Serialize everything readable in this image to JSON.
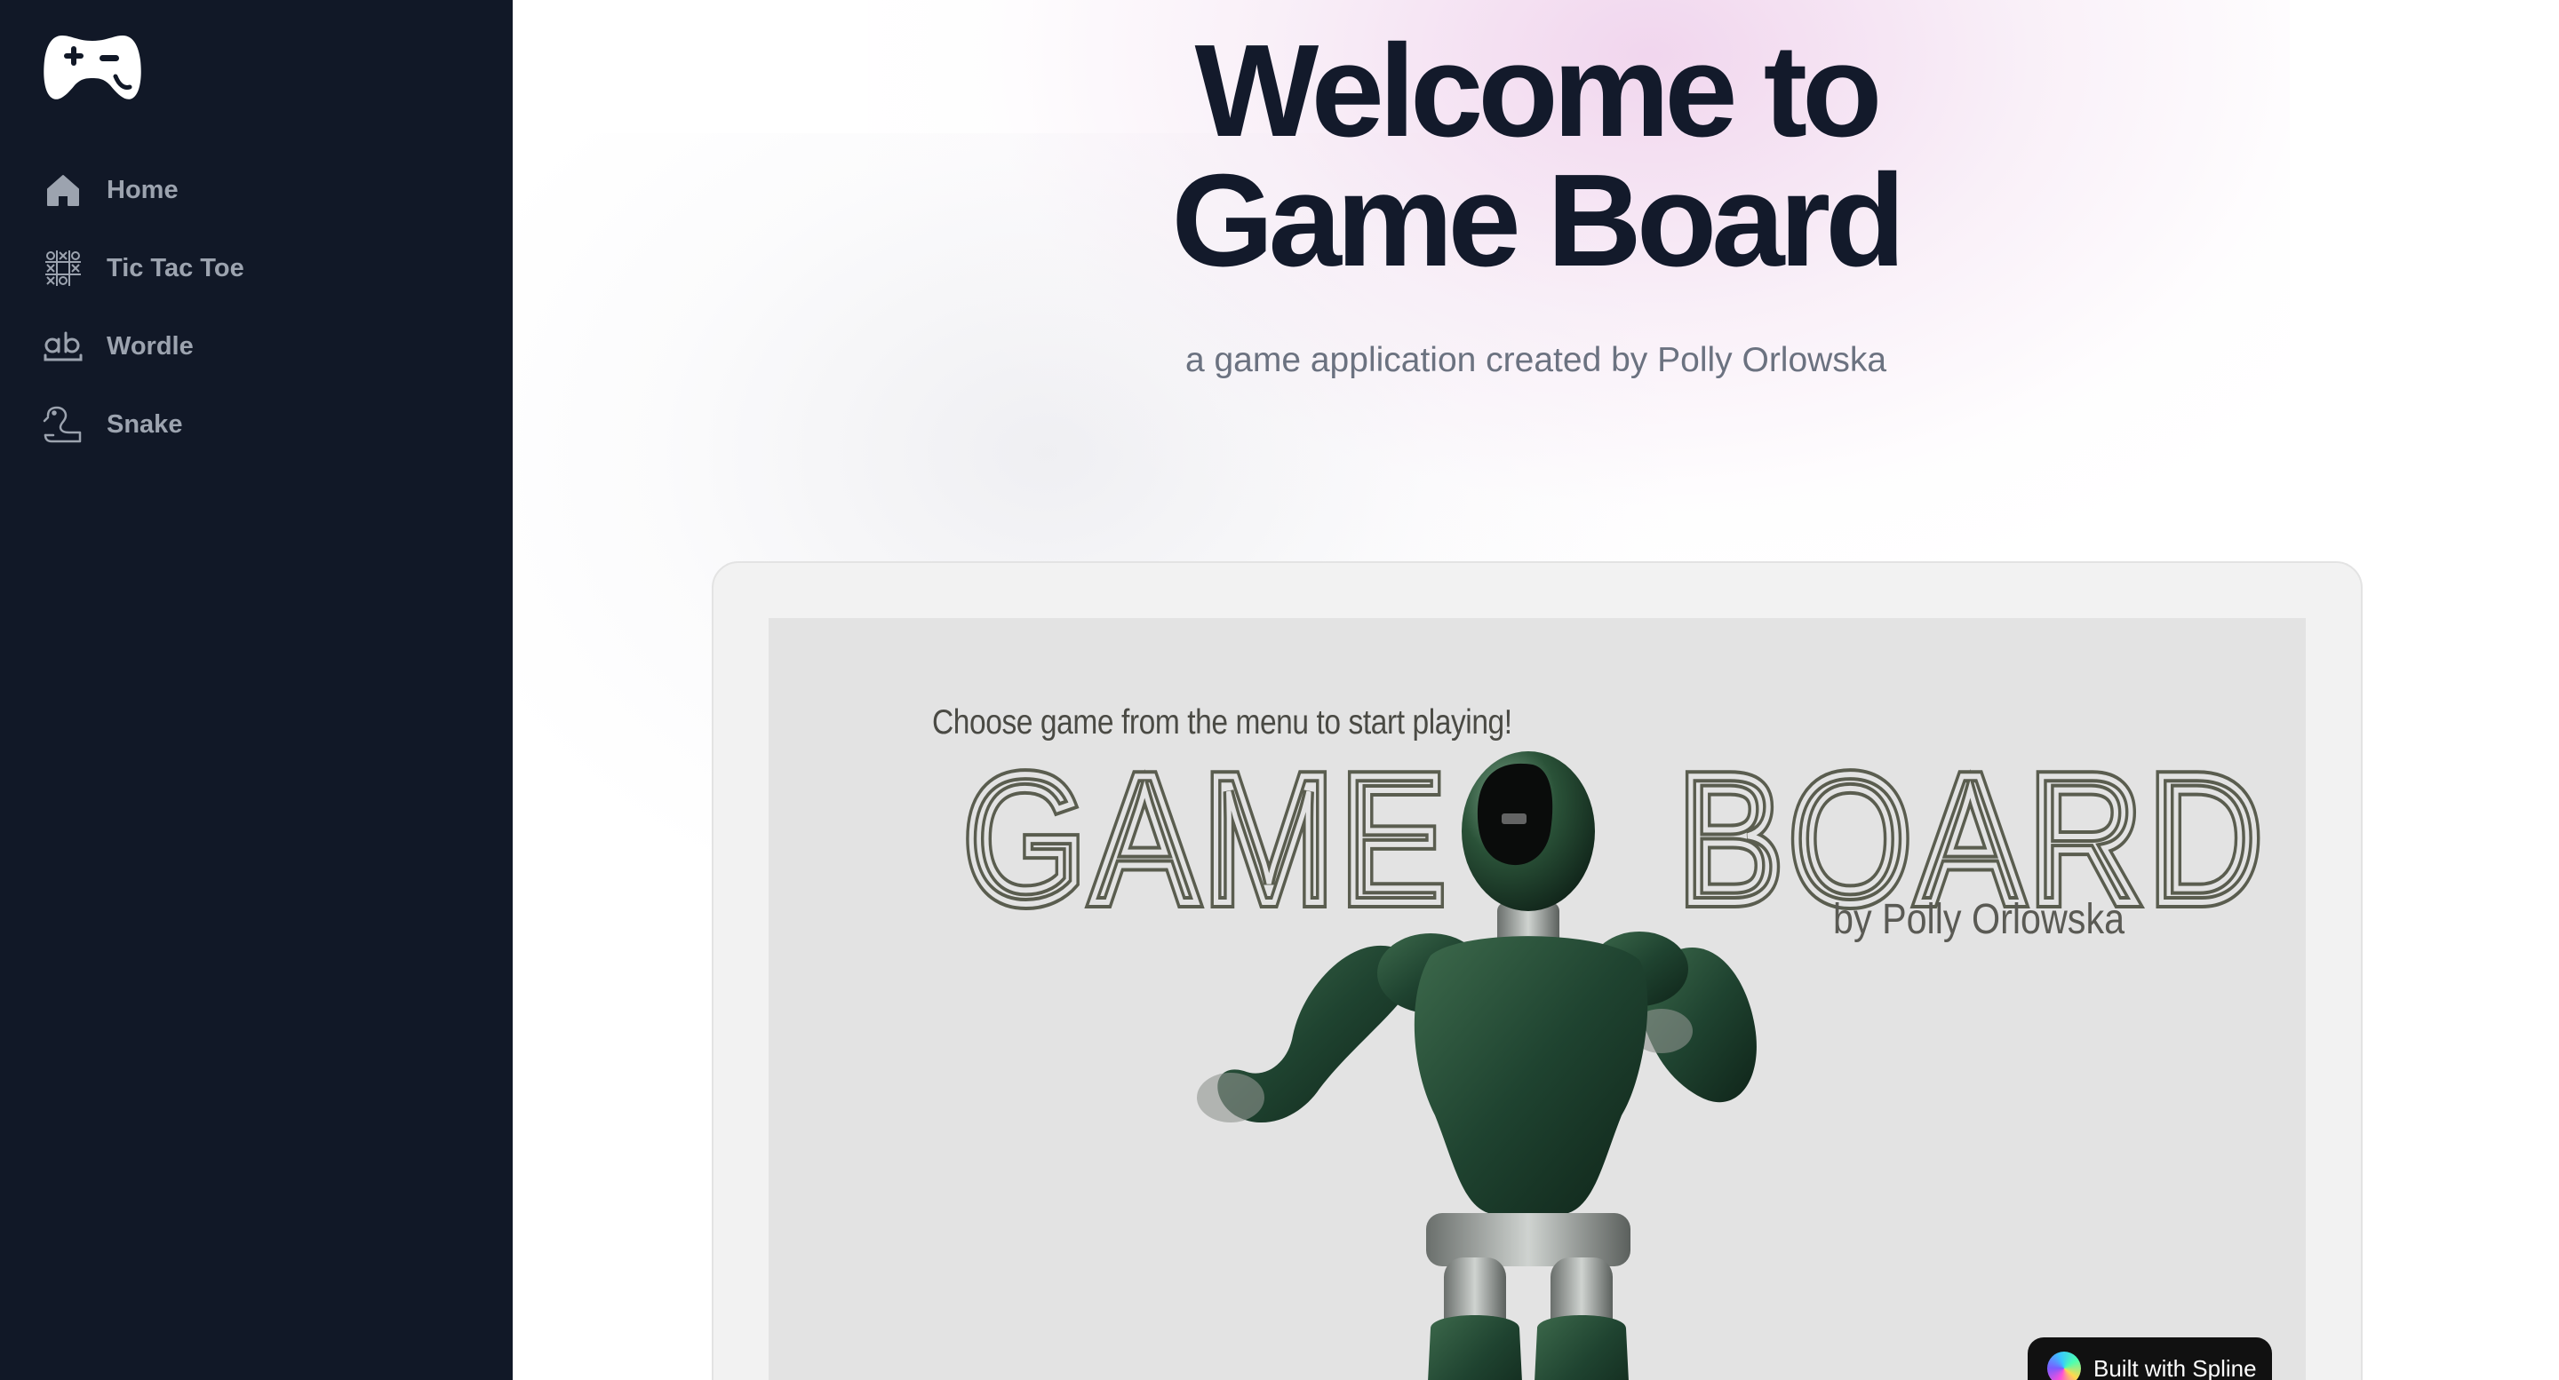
{
  "sidebar": {
    "logo_icon": "gamepad-icon",
    "items": [
      {
        "label": "Home",
        "icon": "home-icon"
      },
      {
        "label": "Tic Tac Toe",
        "icon": "tic-tac-toe-icon"
      },
      {
        "label": "Wordle",
        "icon": "wordle-ab-icon"
      },
      {
        "label": "Snake",
        "icon": "snake-icon"
      }
    ],
    "bg_color": "#111827",
    "label_color": "#9ca3af"
  },
  "hero": {
    "title_line1": "Welcome to",
    "title_line2": "Game Board",
    "subtitle": "a game application created by Polly Orlowska",
    "title_color": "#131a2b",
    "subtitle_color": "#6b7280"
  },
  "scene": {
    "hint": "Choose game from the menu to start playing!",
    "logo_text_left": "GAME",
    "logo_text_right": "BOARD",
    "byline": "by Polly Orlowska",
    "character": "robot-figure",
    "badge_label": "Built with Spline"
  }
}
